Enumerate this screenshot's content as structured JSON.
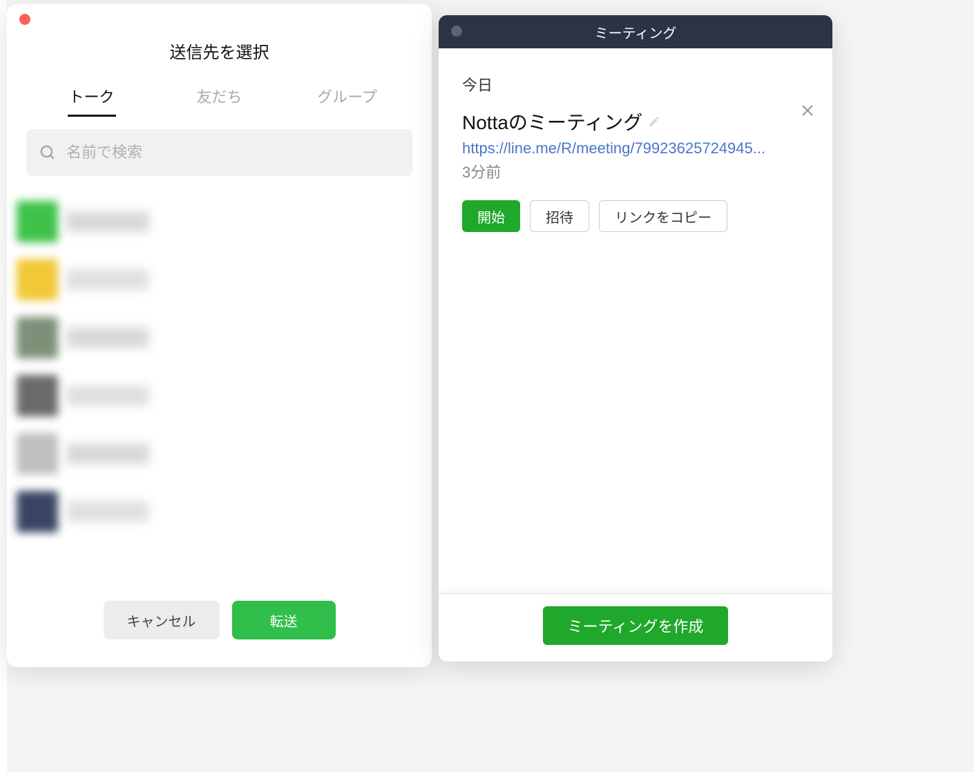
{
  "dialog": {
    "title": "送信先を選択",
    "tabs": {
      "talk": "トーク",
      "friends": "友だち",
      "group": "グループ"
    },
    "search_placeholder": "名前で検索",
    "contacts": [
      {
        "avatar_color": "#3fc24a",
        "name_color": "#d8d8d8"
      },
      {
        "avatar_color": "#f0c838",
        "name_color": "#e0e0e0"
      },
      {
        "avatar_color": "#7d9078",
        "name_color": "#d8d8d8"
      },
      {
        "avatar_color": "#6a6a6a",
        "name_color": "#e0e0e0"
      },
      {
        "avatar_color": "#bfbfbf",
        "name_color": "#d8d8d8"
      },
      {
        "avatar_color": "#3a4566",
        "name_color": "#e0e0e0"
      }
    ],
    "cancel_label": "キャンセル",
    "send_label": "転送"
  },
  "meeting": {
    "window_title": "ミーティング",
    "date_label": "今日",
    "title": "Nottaのミーティング",
    "link": "https://line.me/R/meeting/79923625724945...",
    "timestamp": "3分前",
    "start_label": "開始",
    "invite_label": "招待",
    "copy_label": "リンクをコピー",
    "create_label": "ミーティングを作成"
  }
}
